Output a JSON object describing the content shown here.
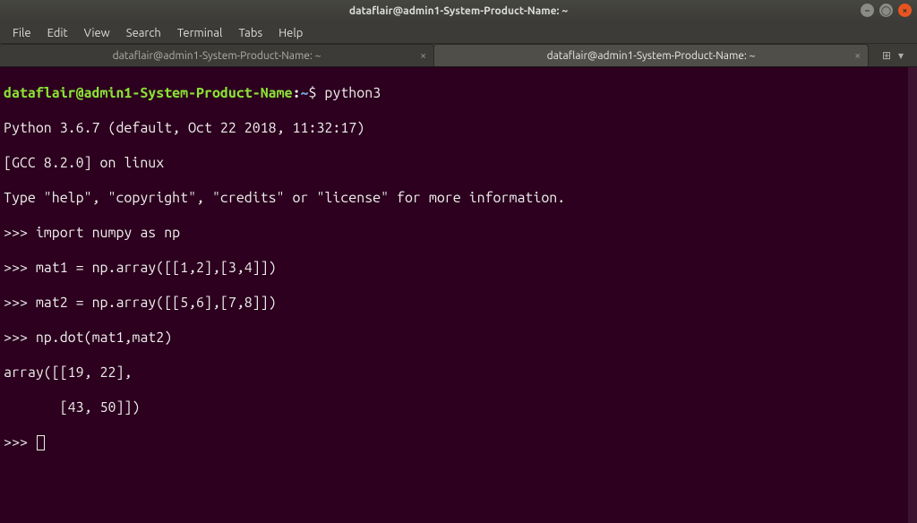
{
  "window": {
    "title": "dataflair@admin1-System-Product-Name: ~"
  },
  "menu": {
    "file": "File",
    "edit": "Edit",
    "view": "View",
    "search": "Search",
    "terminal": "Terminal",
    "tabs": "Tabs",
    "help": "Help"
  },
  "tabs": [
    {
      "label": "dataflair@admin1-System-Product-Name: ~",
      "active": false
    },
    {
      "label": "dataflair@admin1-System-Product-Name: ~",
      "active": true
    }
  ],
  "prompt": {
    "user_host": "dataflair@admin1-System-Product-Name",
    "colon": ":",
    "path": "~",
    "symbol": "$"
  },
  "term": {
    "cmd0": " python3",
    "line1": "Python 3.6.7 (default, Oct 22 2018, 11:32:17) ",
    "line2": "[GCC 8.2.0] on linux",
    "line3": "Type \"help\", \"copyright\", \"credits\" or \"license\" for more information.",
    "pp": ">>> ",
    "in1": "import numpy as np",
    "in2": "mat1 = np.array([[1,2],[3,4]])",
    "in3": "mat2 = np.array([[5,6],[7,8]])",
    "in4": "np.dot(mat1,mat2)",
    "out1": "array([[19, 22],",
    "out2": "       [43, 50]])"
  },
  "icons": {
    "close_x": "×",
    "chevron_down": "▾"
  }
}
